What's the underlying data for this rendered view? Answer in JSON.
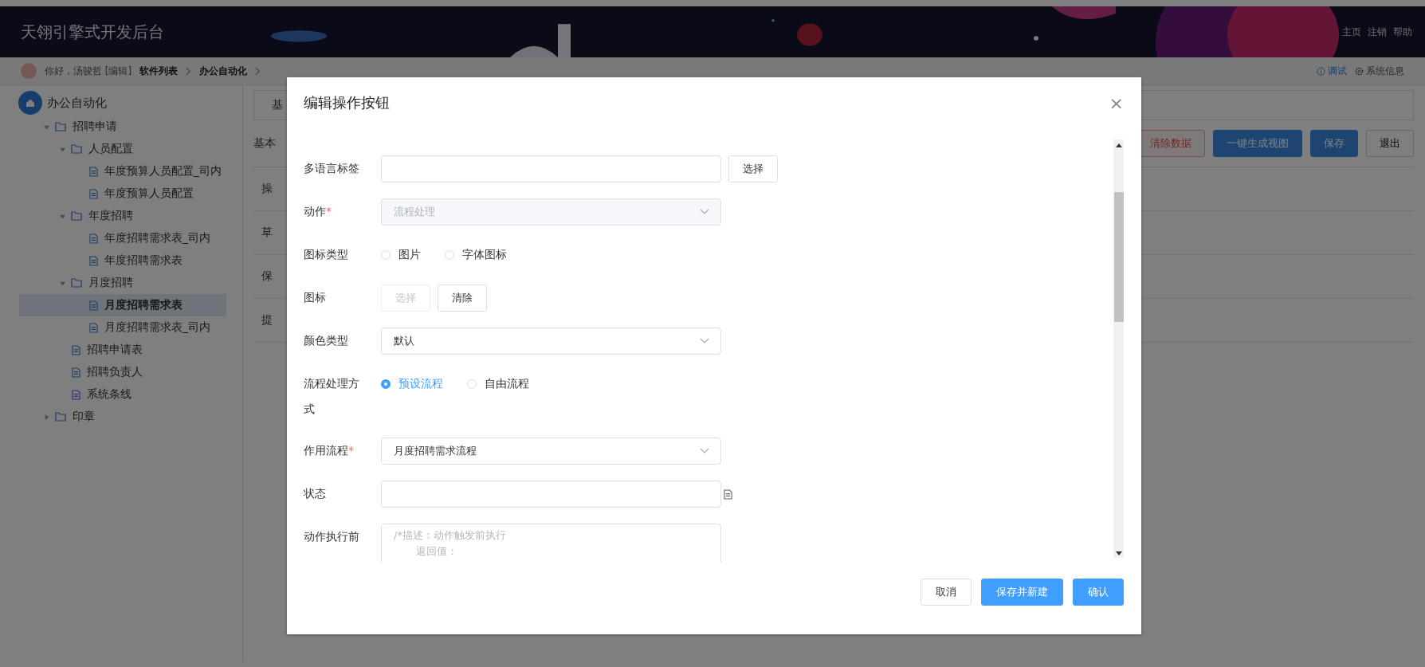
{
  "header": {
    "title": "天翎引擎式开发后台",
    "links": [
      "主页",
      "注销",
      "帮助"
    ]
  },
  "breadcrumb": {
    "greeting": "你好，汤骏哲 [编辑]",
    "items": [
      "软件列表",
      "办公自动化"
    ],
    "actions": [
      {
        "kind": "info",
        "label": "调试"
      },
      {
        "kind": "gear",
        "label": "系统信息"
      }
    ]
  },
  "sidebar": {
    "root": "办公自动化",
    "items": [
      {
        "kind": "folder",
        "label": "招聘申请",
        "expanded": true,
        "selected": false,
        "children": [
          {
            "kind": "folder",
            "label": "人员配置",
            "expanded": true,
            "selected": false,
            "children": [
              {
                "kind": "doc",
                "label": "年度预算人员配置_司内",
                "selected": false
              },
              {
                "kind": "doc",
                "label": "年度预算人员配置",
                "selected": false
              }
            ]
          },
          {
            "kind": "folder",
            "label": "年度招聘",
            "expanded": true,
            "selected": false,
            "children": [
              {
                "kind": "doc",
                "label": "年度招聘需求表_司内",
                "selected": false
              },
              {
                "kind": "doc",
                "label": "年度招聘需求表",
                "selected": false
              }
            ]
          },
          {
            "kind": "folder",
            "label": "月度招聘",
            "expanded": true,
            "selected": false,
            "children": [
              {
                "kind": "doc",
                "label": "月度招聘需求表",
                "selected": true
              },
              {
                "kind": "doc",
                "label": "月度招聘需求表_司内",
                "selected": false
              }
            ]
          },
          {
            "kind": "doc",
            "label": "招聘申请表",
            "selected": false
          },
          {
            "kind": "doc",
            "label": "招聘负责人",
            "selected": false
          },
          {
            "kind": "doc",
            "label": "系统条线",
            "selected": false
          }
        ]
      },
      {
        "kind": "folder",
        "label": "印章",
        "expanded": false,
        "selected": false
      }
    ]
  },
  "main": {
    "tab": "基",
    "section": "基本",
    "buttons": [
      {
        "kind": "danger",
        "label": "清除数据"
      },
      {
        "kind": "primary",
        "label": "一键生成视图"
      },
      {
        "kind": "primary",
        "label": "保存"
      },
      {
        "kind": "default",
        "label": "退出"
      }
    ],
    "rows": [
      "操",
      "草",
      "保",
      "提"
    ]
  },
  "dialog": {
    "title": "编辑操作按钮",
    "close": "×",
    "fields": [
      {
        "kind": "input",
        "label": "多语言标签",
        "button": "选择"
      },
      {
        "kind": "select",
        "label": "动作",
        "required_mark": "*",
        "value": "流程处理",
        "disabled": true
      },
      {
        "kind": "radio",
        "label": "图标类型",
        "options": [
          {
            "label": "图片",
            "selected": false
          },
          {
            "label": "字体图标",
            "selected": false
          }
        ]
      },
      {
        "kind": "buttons",
        "label": "图标",
        "buttons": [
          {
            "label": "选择",
            "disabled": true
          },
          {
            "label": "清除",
            "disabled": false
          }
        ]
      },
      {
        "kind": "select",
        "label": "颜色类型",
        "value": "默认",
        "disabled": false
      },
      {
        "kind": "radio",
        "label": "流程处理方式",
        "options": [
          {
            "label": "预设流程",
            "selected": true
          },
          {
            "label": "自由流程",
            "selected": false
          }
        ]
      },
      {
        "kind": "select",
        "label": "作用流程",
        "required_mark": "*",
        "value": "月度招聘需求流程",
        "disabled": false
      },
      {
        "kind": "input",
        "label": "状态",
        "doc_icon": true
      },
      {
        "kind": "textarea",
        "label": "动作执行前",
        "placeholder_lines": [
          "/*描述：动作触发前执行",
          "返回值："
        ]
      }
    ],
    "footer": [
      {
        "kind": "default",
        "label": "取消"
      },
      {
        "kind": "primary",
        "label": "保存并新建"
      },
      {
        "kind": "primary",
        "label": "确认"
      }
    ]
  }
}
